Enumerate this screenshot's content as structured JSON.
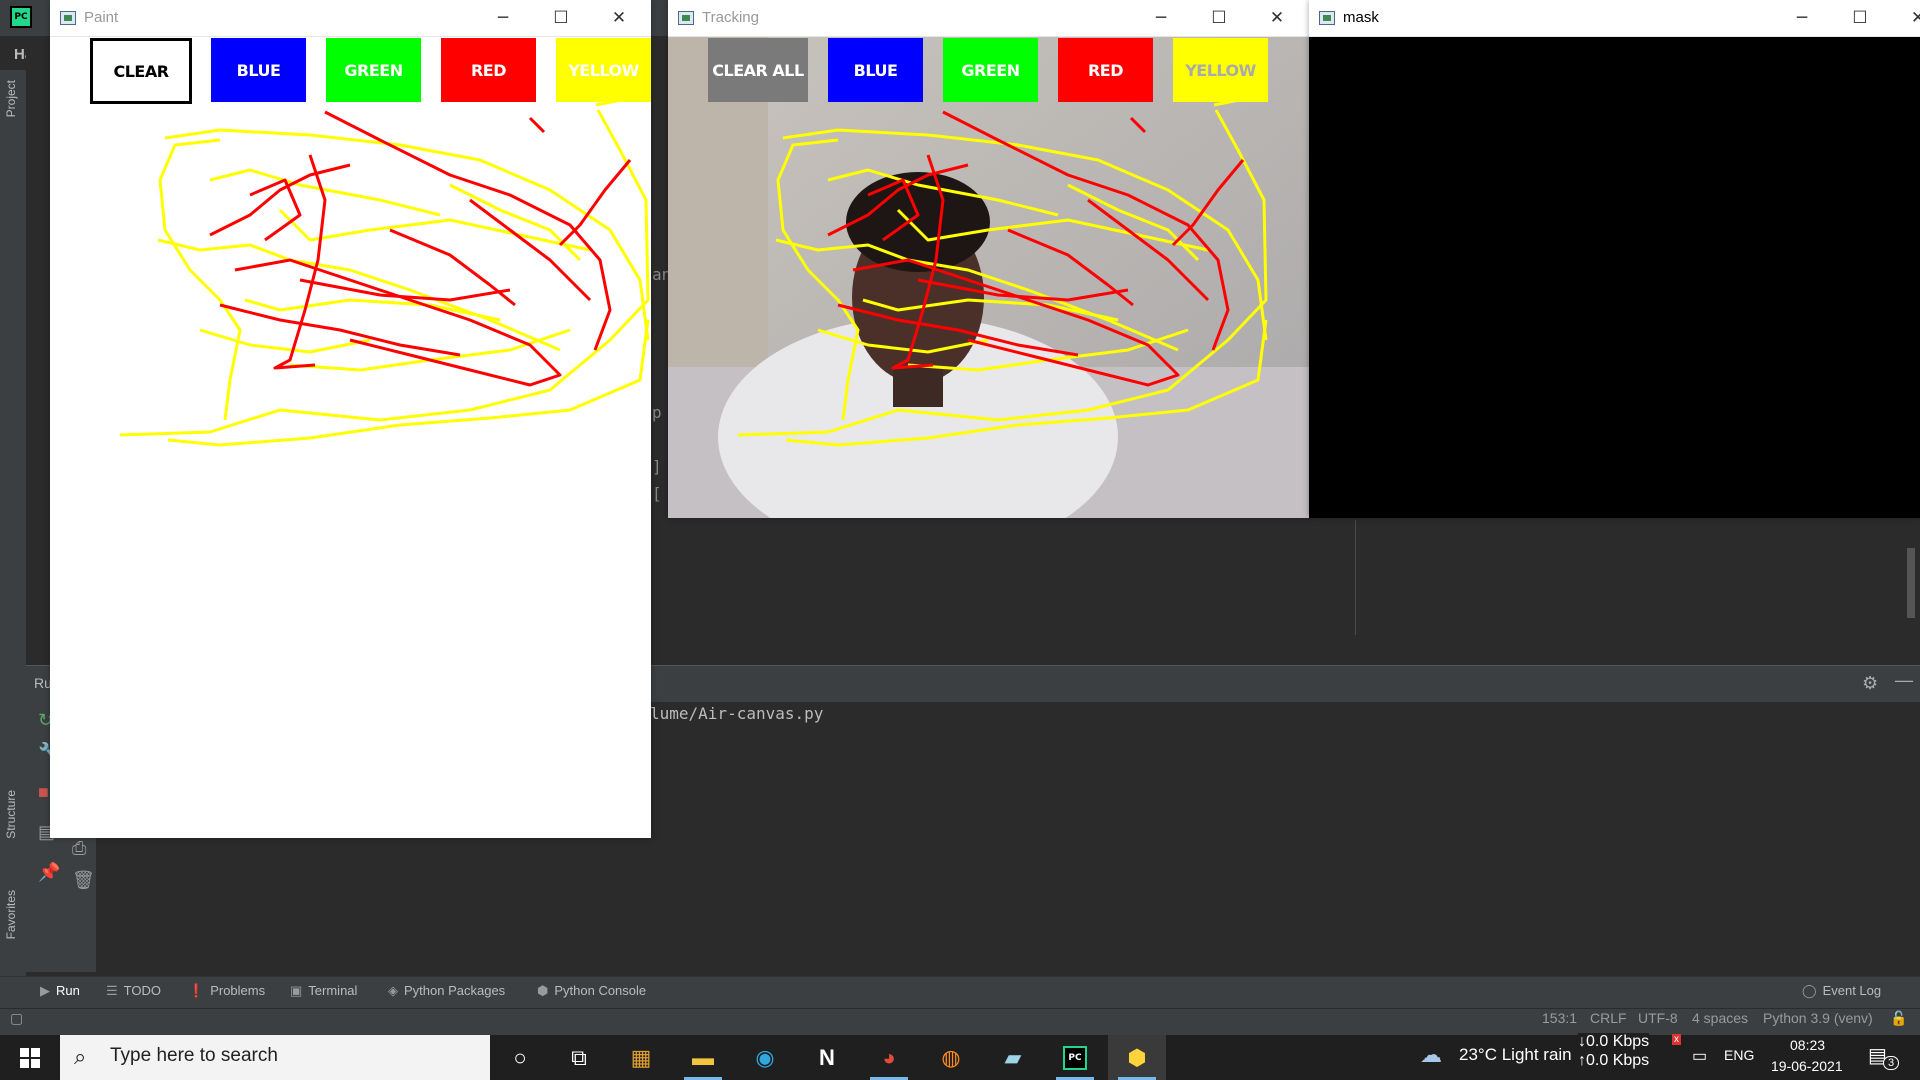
{
  "ide": {
    "project_name": "Hand",
    "left_tools": [
      "Project",
      "Structure",
      "Favorites"
    ],
    "run_panel_label": "Ru",
    "console_line": "lume/Air-canvas.py",
    "editor_fragments": [
      "an",
      "p",
      "]",
      "["
    ],
    "bottom_tabs": [
      {
        "label": "Run",
        "icon": "run-icon"
      },
      {
        "label": "TODO",
        "icon": "todo-icon"
      },
      {
        "label": "Problems",
        "icon": "problems-icon"
      },
      {
        "label": "Terminal",
        "icon": "terminal-icon"
      },
      {
        "label": "Python Packages",
        "icon": "packages-icon"
      },
      {
        "label": "Python Console",
        "icon": "python-console-icon"
      }
    ],
    "event_log": "Event Log",
    "status": {
      "position": "153:1",
      "line_separator": "CRLF",
      "encoding": "UTF-8",
      "indent": "4 spaces",
      "interpreter": "Python 3.9 (venv)"
    }
  },
  "windows": {
    "paint": {
      "title": "Paint",
      "buttons": [
        {
          "label": "CLEAR",
          "color": "#ffffff",
          "text_color": "#000000"
        },
        {
          "label": "BLUE",
          "color": "#0000ff",
          "text_color": "#ffffff"
        },
        {
          "label": "GREEN",
          "color": "#00ff00",
          "text_color": "#ffffff"
        },
        {
          "label": "RED",
          "color": "#ff0000",
          "text_color": "#ffffff"
        },
        {
          "label": "YELLOW",
          "color": "#ffff00",
          "text_color": "#ffffff"
        }
      ]
    },
    "tracking": {
      "title": "Tracking",
      "buttons": [
        {
          "label": "CLEAR ALL",
          "color": "#7a7a7a",
          "text_color": "#ffffff"
        },
        {
          "label": "BLUE",
          "color": "#0000ff",
          "text_color": "#ffffff"
        },
        {
          "label": "GREEN",
          "color": "#00ff00",
          "text_color": "#ffffff"
        },
        {
          "label": "RED",
          "color": "#ff0000",
          "text_color": "#ffffff"
        },
        {
          "label": "YELLOW",
          "color": "#ffff00",
          "text_color": "#aaaaaa"
        }
      ]
    },
    "mask": {
      "title": "mask"
    },
    "stroke_colors": {
      "red": "#ff0000",
      "yellow": "#ffff00"
    }
  },
  "taskbar": {
    "search_placeholder": "Type here to search",
    "apps": [
      "cortana-icon",
      "task-view-icon",
      "store-icon",
      "file-explorer-icon",
      "edge-icon",
      "notion-icon",
      "chrome-icon",
      "firefox-icon",
      "notepad-icon",
      "pycharm-icon",
      "python-icon"
    ],
    "weather": "23°C  Light rain",
    "net_down": "0.0 Kbps",
    "net_up": "0.0 Kbps",
    "language": "ENG",
    "time": "08:23",
    "date": "19-06-2021",
    "notifications": "3"
  }
}
